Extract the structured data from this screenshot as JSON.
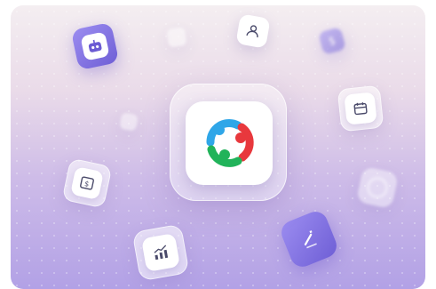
{
  "scene": {
    "main_icon": "people-circle-logo-icon",
    "floating_icons": [
      "robot-icon",
      "user-badge-icon",
      "currency-icon",
      "calendar-icon",
      "money-card-icon",
      "bar-chart-icon",
      "pen-edit-icon"
    ],
    "colors": {
      "bg_top": "#f4eef1",
      "bg_bottom": "#b2a1e6",
      "logo_blue": "#2fa6e8",
      "logo_red": "#e8383d",
      "logo_green": "#21b35a"
    }
  }
}
